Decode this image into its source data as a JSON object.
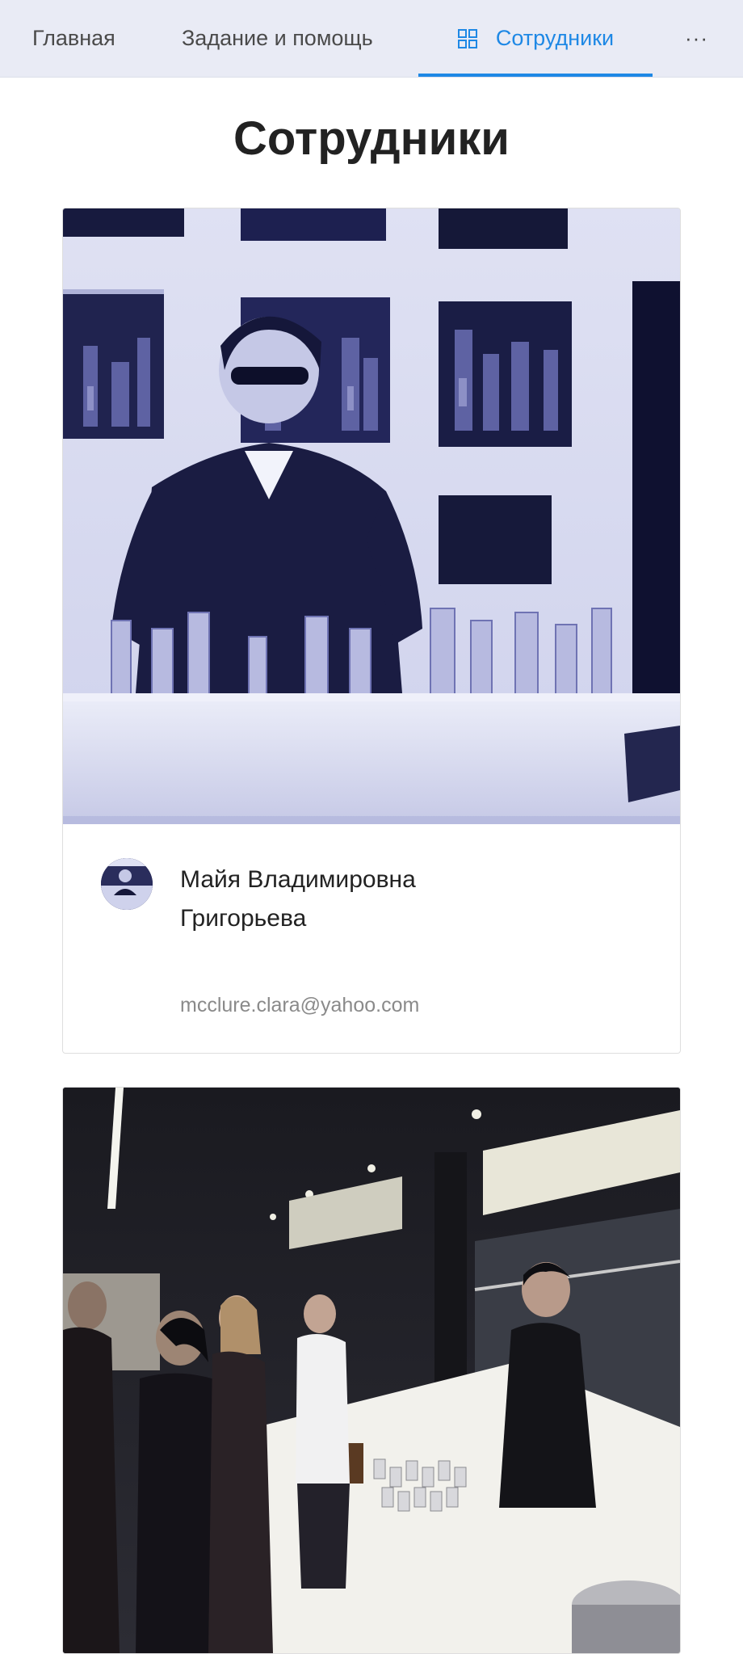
{
  "nav": {
    "home_label": "Главная",
    "help_label": "Задание и помощь",
    "staff_label": "Сотрудники",
    "more_label": "···",
    "staff_icon": "grid-icon",
    "accent_color": "#1e88e5"
  },
  "page": {
    "title": "Сотрудники"
  },
  "employees": [
    {
      "name": "Майя Владимировна Григорьева",
      "email": "mcclure.clara@yahoo.com"
    }
  ]
}
